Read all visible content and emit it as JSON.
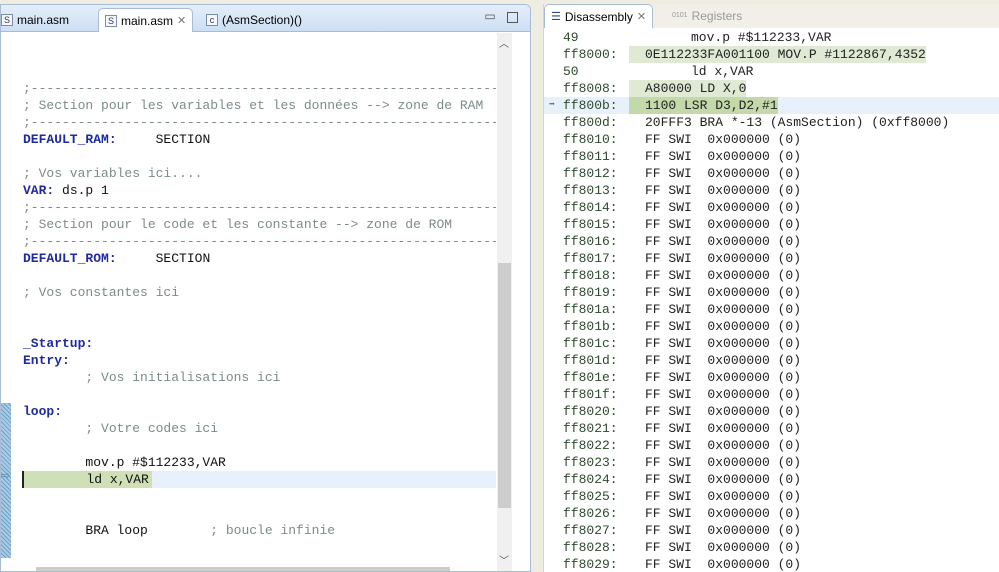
{
  "editor": {
    "tabs": [
      {
        "label": "main.asm",
        "icon": "asm-file-icon"
      },
      {
        "label": "main.asm",
        "icon": "asm-file-icon",
        "active": true
      },
      {
        "label": "(AsmSection)()",
        "icon": "c-file-icon"
      }
    ],
    "lines": [
      {
        "text": ";-----------------------------------------------------------------------",
        "kind": "comment"
      },
      {
        "text": "; Section pour les variables et les données --> zone de RAM",
        "kind": "comment"
      },
      {
        "text": ";-----------------------------------------------------------------------",
        "kind": "comment"
      },
      {
        "text": "DEFAULT_RAM:",
        "extra": "     SECTION",
        "kind": "label"
      },
      {
        "text": "",
        "kind": "plain"
      },
      {
        "text": "; Vos variables ici....",
        "kind": "comment"
      },
      {
        "text": "VAR:",
        "extra": " ds.p 1",
        "kind": "label"
      },
      {
        "text": ";-----------------------------------------------------------------------",
        "kind": "comment"
      },
      {
        "text": "; Section pour le code et les constante --> zone de ROM",
        "kind": "comment"
      },
      {
        "text": ";-----------------------------------------------------------------------",
        "kind": "comment"
      },
      {
        "text": "DEFAULT_ROM:",
        "extra": "     SECTION",
        "kind": "label"
      },
      {
        "text": "",
        "kind": "plain"
      },
      {
        "text": "; Vos constantes ici",
        "kind": "comment"
      },
      {
        "text": "",
        "kind": "plain"
      },
      {
        "text": "",
        "kind": "plain"
      },
      {
        "text": "_Startup:",
        "kind": "label"
      },
      {
        "text": "Entry:",
        "kind": "label"
      },
      {
        "text": "        ; Vos initialisations ici",
        "kind": "comment"
      },
      {
        "text": "",
        "kind": "plain"
      },
      {
        "text": "loop:",
        "kind": "label"
      },
      {
        "text": "        ; Votre codes ici",
        "kind": "comment"
      },
      {
        "text": "",
        "kind": "plain"
      },
      {
        "text": "        mov.p #$112233,VAR",
        "kind": "plain"
      },
      {
        "text": "        ld x,VAR",
        "kind": "plain",
        "current": true
      },
      {
        "text": "",
        "kind": "plain"
      },
      {
        "text": "",
        "kind": "plain"
      },
      {
        "text": "        BRA loop",
        "extra": "        ; boucle infinie",
        "kind": "plain"
      }
    ]
  },
  "disassembly": {
    "tab_label": "Disassembly",
    "registers_label": "Registers",
    "rows": [
      {
        "addr": "49",
        "src": "mov.p #$112233,VAR"
      },
      {
        "addr": "ff8000:",
        "ins": "0E112233FA001100 MOV.P #1122867,4352",
        "hl": "hl1"
      },
      {
        "addr": "50",
        "src": "ld x,VAR"
      },
      {
        "addr": "ff8008:",
        "ins": "A80000 LD X,0",
        "hl": "hl1"
      },
      {
        "addr": "ff800b:",
        "ins": "1100 LSR D3,D2,#1",
        "hl": "hl2",
        "pc": true
      },
      {
        "addr": "ff800d:",
        "ins": "20FFF3 BRA *-13 (AsmSection) (0xff8000)"
      },
      {
        "addr": "ff8010:",
        "ins": "FF SWI  0x000000 (0)"
      },
      {
        "addr": "ff8011:",
        "ins": "FF SWI  0x000000 (0)"
      },
      {
        "addr": "ff8012:",
        "ins": "FF SWI  0x000000 (0)"
      },
      {
        "addr": "ff8013:",
        "ins": "FF SWI  0x000000 (0)"
      },
      {
        "addr": "ff8014:",
        "ins": "FF SWI  0x000000 (0)"
      },
      {
        "addr": "ff8015:",
        "ins": "FF SWI  0x000000 (0)"
      },
      {
        "addr": "ff8016:",
        "ins": "FF SWI  0x000000 (0)"
      },
      {
        "addr": "ff8017:",
        "ins": "FF SWI  0x000000 (0)"
      },
      {
        "addr": "ff8018:",
        "ins": "FF SWI  0x000000 (0)"
      },
      {
        "addr": "ff8019:",
        "ins": "FF SWI  0x000000 (0)"
      },
      {
        "addr": "ff801a:",
        "ins": "FF SWI  0x000000 (0)"
      },
      {
        "addr": "ff801b:",
        "ins": "FF SWI  0x000000 (0)"
      },
      {
        "addr": "ff801c:",
        "ins": "FF SWI  0x000000 (0)"
      },
      {
        "addr": "ff801d:",
        "ins": "FF SWI  0x000000 (0)"
      },
      {
        "addr": "ff801e:",
        "ins": "FF SWI  0x000000 (0)"
      },
      {
        "addr": "ff801f:",
        "ins": "FF SWI  0x000000 (0)"
      },
      {
        "addr": "ff8020:",
        "ins": "FF SWI  0x000000 (0)"
      },
      {
        "addr": "ff8021:",
        "ins": "FF SWI  0x000000 (0)"
      },
      {
        "addr": "ff8022:",
        "ins": "FF SWI  0x000000 (0)"
      },
      {
        "addr": "ff8023:",
        "ins": "FF SWI  0x000000 (0)"
      },
      {
        "addr": "ff8024:",
        "ins": "FF SWI  0x000000 (0)"
      },
      {
        "addr": "ff8025:",
        "ins": "FF SWI  0x000000 (0)"
      },
      {
        "addr": "ff8026:",
        "ins": "FF SWI  0x000000 (0)"
      },
      {
        "addr": "ff8027:",
        "ins": "FF SWI  0x000000 (0)"
      },
      {
        "addr": "ff8028:",
        "ins": "FF SWI  0x000000 (0)"
      },
      {
        "addr": "ff8029:",
        "ins": "FF SWI  0x000000 (0)"
      }
    ]
  }
}
